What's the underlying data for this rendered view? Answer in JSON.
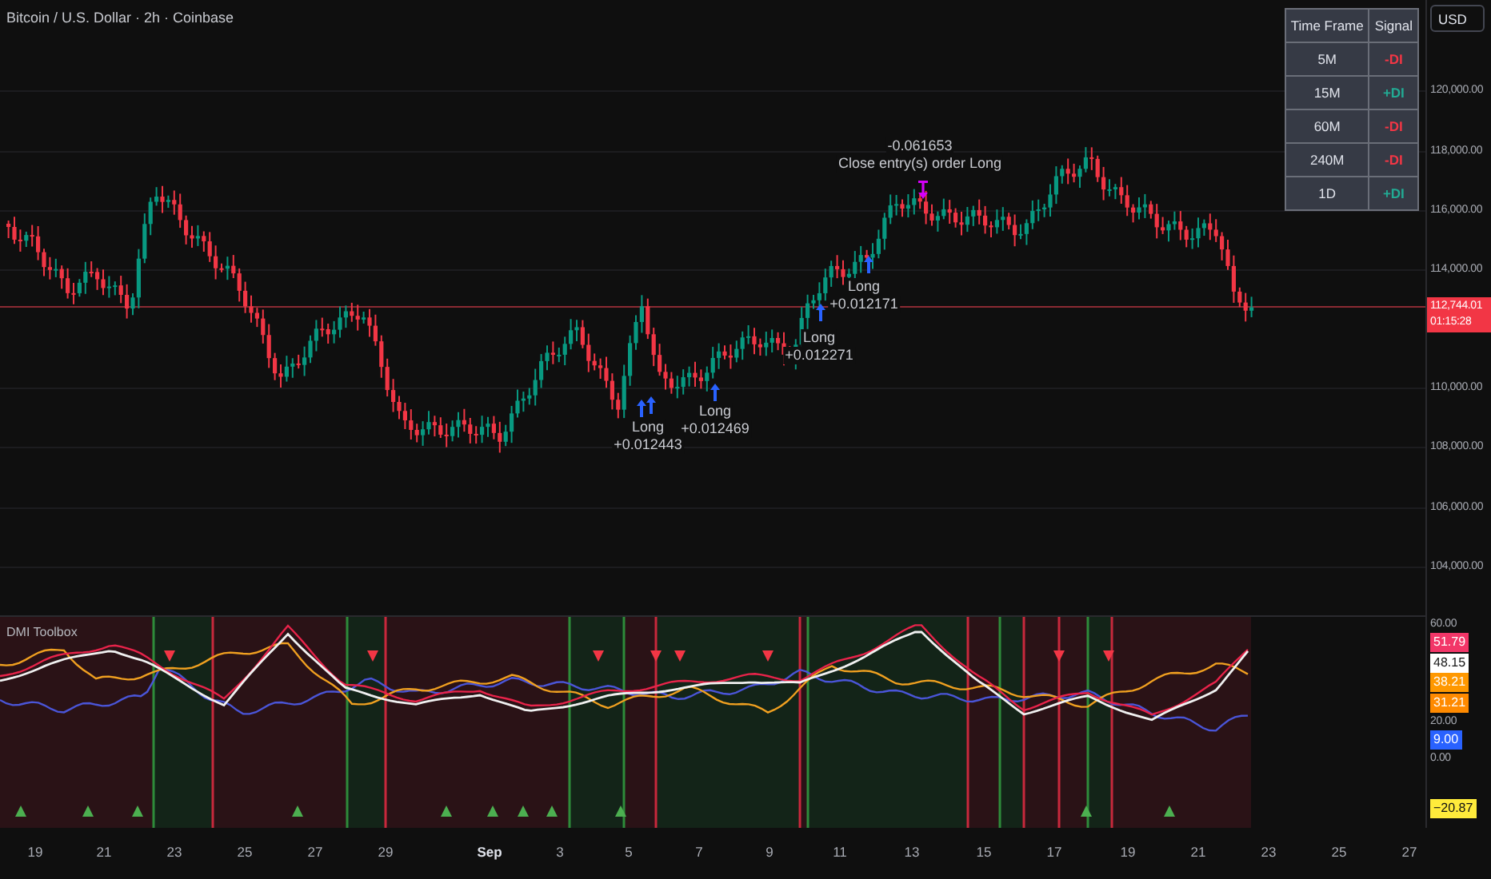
{
  "chart_title": "Bitcoin / U.S. Dollar · 2h · Coinbase",
  "currency": "USD",
  "signal_table": {
    "columns": [
      "Time Frame",
      "Signal"
    ],
    "rows": [
      {
        "time_frame": "5M",
        "signal": "-DI",
        "color": "#f23645"
      },
      {
        "time_frame": "15M",
        "signal": "+DI",
        "color": "#22ab94"
      },
      {
        "time_frame": "60M",
        "signal": "-DI",
        "color": "#f23645"
      },
      {
        "time_frame": "240M",
        "signal": "-DI",
        "color": "#f23645"
      },
      {
        "time_frame": "1D",
        "signal": "+DI",
        "color": "#22ab94"
      }
    ]
  },
  "price_axis": [
    "120,000.00",
    "118,000.00",
    "116,000.00",
    "114,000.00",
    "110,000.00",
    "108,000.00",
    "106,000.00",
    "104,000.00"
  ],
  "last_price": {
    "price": "112,744.01",
    "countdown": "01:15:28"
  },
  "trade_labels": [
    {
      "kind": "exit",
      "value": "-0.061653",
      "text": "Close entry(s) order Long"
    },
    {
      "kind": "entry",
      "text": "Long",
      "value": "+0.012171"
    },
    {
      "kind": "entry",
      "text": "Long",
      "value": "+0.012271"
    },
    {
      "kind": "entry",
      "text": "Long",
      "value": "+0.012469"
    },
    {
      "kind": "entry",
      "text": "Long",
      "value": "+0.012443"
    }
  ],
  "indicator": {
    "title": "DMI Toolbox",
    "axis": [
      "60.00",
      "20.00",
      "0.00"
    ],
    "value_tags": [
      {
        "text": "51.79",
        "color": "#f23668"
      },
      {
        "text": "48.15",
        "color": "#ffffff"
      },
      {
        "text": "38.21",
        "color": "#ff9800"
      },
      {
        "text": "31.21",
        "color": "#ff8a00"
      },
      {
        "text": "9.00",
        "color": "#2962ff"
      },
      {
        "text": "−20.87",
        "color": "#ffeb3b"
      }
    ]
  },
  "time_axis": [
    {
      "label": "19",
      "kind": "day"
    },
    {
      "label": "21",
      "kind": "day"
    },
    {
      "label": "23",
      "kind": "day"
    },
    {
      "label": "25",
      "kind": "day"
    },
    {
      "label": "27",
      "kind": "day"
    },
    {
      "label": "29",
      "kind": "day"
    },
    {
      "label": "Sep",
      "kind": "month"
    },
    {
      "label": "3",
      "kind": "day"
    },
    {
      "label": "5",
      "kind": "day"
    },
    {
      "label": "7",
      "kind": "day"
    },
    {
      "label": "9",
      "kind": "day"
    },
    {
      "label": "11",
      "kind": "day"
    },
    {
      "label": "13",
      "kind": "day"
    },
    {
      "label": "15",
      "kind": "day"
    },
    {
      "label": "17",
      "kind": "day"
    },
    {
      "label": "19",
      "kind": "day"
    },
    {
      "label": "21",
      "kind": "day"
    },
    {
      "label": "23",
      "kind": "day"
    },
    {
      "label": "25",
      "kind": "day"
    },
    {
      "label": "27",
      "kind": "day"
    }
  ]
}
